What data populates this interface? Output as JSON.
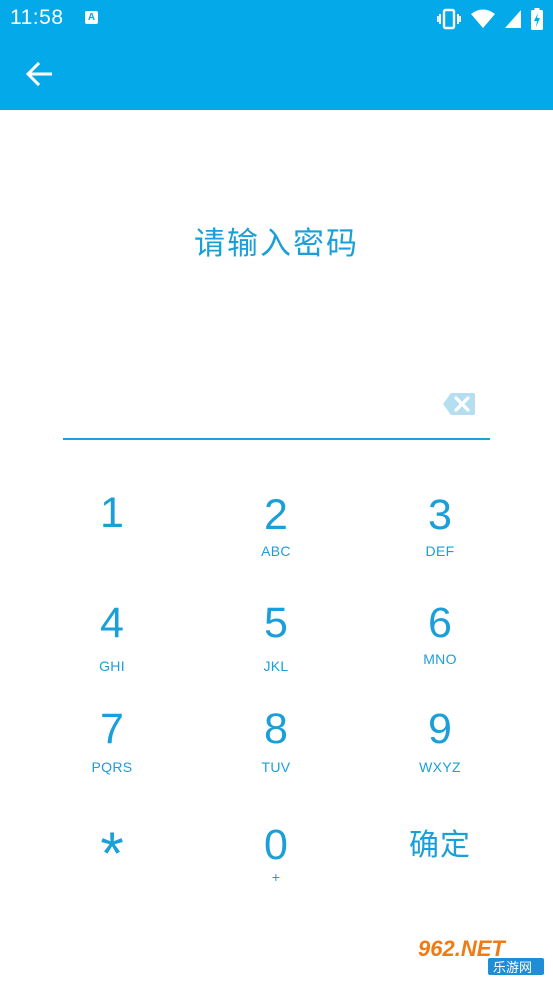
{
  "status_bar": {
    "time": "11:58",
    "notification_badge": "A",
    "icons": [
      "vibrate-icon",
      "wifi-icon",
      "cell-signal-icon",
      "battery-charging-icon"
    ]
  },
  "toolbar": {
    "back_icon": "arrow-left-icon"
  },
  "prompt": {
    "title": "请输入密码"
  },
  "password": {
    "value": "",
    "clear_icon": "backspace-icon"
  },
  "keypad": {
    "keys": [
      {
        "num": "1",
        "sub": ""
      },
      {
        "num": "2",
        "sub": "ABC"
      },
      {
        "num": "3",
        "sub": "DEF"
      },
      {
        "num": "4",
        "sub": "GHI"
      },
      {
        "num": "5",
        "sub": "JKL"
      },
      {
        "num": "6",
        "sub": "MNO"
      },
      {
        "num": "7",
        "sub": "PQRS"
      },
      {
        "num": "8",
        "sub": "TUV"
      },
      {
        "num": "9",
        "sub": "WXYZ"
      },
      {
        "num": "*",
        "sub": ""
      },
      {
        "num": "0",
        "sub": "+"
      },
      {
        "num": "确定",
        "sub": ""
      }
    ]
  },
  "watermark": {
    "brand": "962.NET",
    "tagline": "乐游网"
  },
  "colors": {
    "accent": "#03a9e8",
    "text": "#1a9fd9",
    "background": "#ffffff"
  }
}
